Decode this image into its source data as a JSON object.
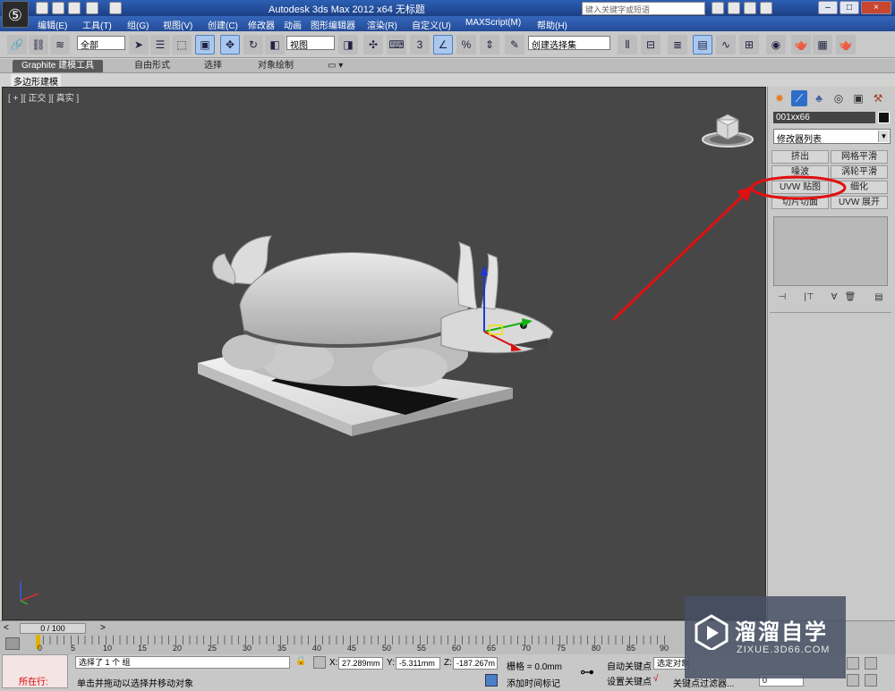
{
  "window": {
    "title": "Autodesk 3ds Max  2012 x64      无标题",
    "search_placeholder": "键入关键字或短语"
  },
  "menu": [
    "编辑(E)",
    "工具(T)",
    "组(G)",
    "视图(V)",
    "创建(C)",
    "修改器",
    "动画",
    "图形编辑器",
    "渲染(R)",
    "自定义(U)",
    "MAXScript(M)",
    "帮助(H)"
  ],
  "toolbar": {
    "selection_filter": "全部",
    "reference_coord": "视图",
    "snap_label": "3",
    "named_selection": "创建选择集"
  },
  "ribbon": {
    "tabs": [
      "Graphite 建模工具",
      "自由形式",
      "选择",
      "对象绘制"
    ],
    "sub_label": "多边形建模"
  },
  "viewport": {
    "label": "[ + ][ 正交 ][ 真实 ]"
  },
  "command_panel": {
    "object_name": "001xx66",
    "modifier_list": "修改器列表",
    "buttons": [
      "挤出",
      "网格平滑",
      "噪波",
      "涡轮平滑",
      "UVW 贴图",
      "细化",
      "切片切面",
      "UVW 展开"
    ]
  },
  "timeline": {
    "frame": "0 / 100",
    "ticks": [
      "0",
      "5",
      "10",
      "15",
      "20",
      "25",
      "30",
      "35",
      "40",
      "45",
      "50",
      "55",
      "60",
      "65",
      "70",
      "75",
      "80",
      "85",
      "90"
    ]
  },
  "status": {
    "script_label": "所在行:",
    "selected": "选择了 1 个 组",
    "prompt": "单击并拖动以选择并移动对象",
    "x_label": "X:",
    "x": "27.289mm",
    "y_label": "Y:",
    "y": "-5.311mm",
    "z_label": "Z:",
    "z": "-187.267m",
    "grid": "栅格 = 0.0mm",
    "add_time_tag": "添加时间标记",
    "auto_key": "自动关键点",
    "set_key": "设置关键点",
    "selected_obj": "选定对象",
    "key_filters": "关键点过滤器...",
    "frame_field": "0"
  },
  "watermark": {
    "title": "溜溜自学",
    "sub": "ZIXUE.3D66.COM"
  },
  "colors": {
    "annotation": "#e01010",
    "viewport_bg": "#474747",
    "panel_bg": "#c9c9c9"
  }
}
